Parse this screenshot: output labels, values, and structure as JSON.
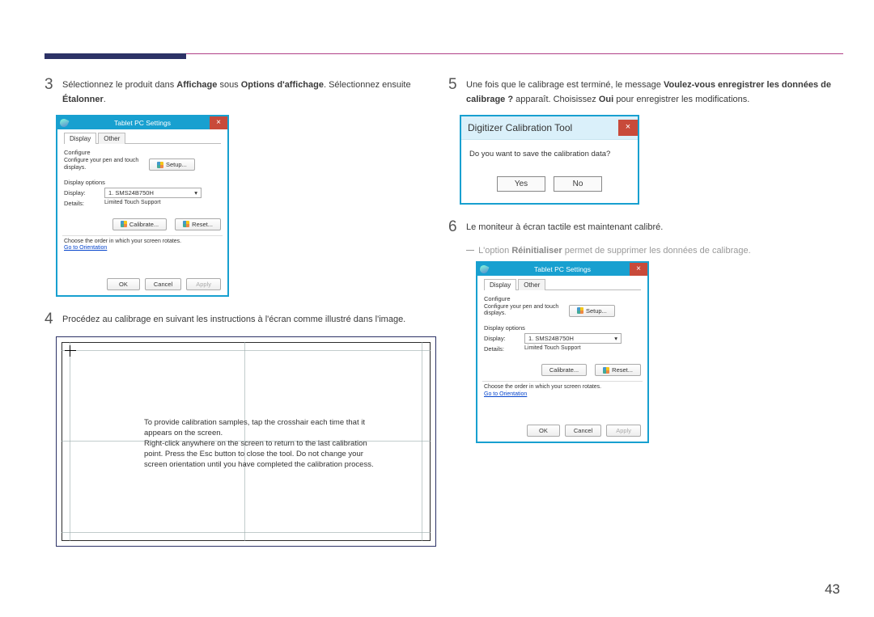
{
  "page_number": "43",
  "step3": {
    "num": "3",
    "text_parts": [
      "Sélectionnez le produit dans ",
      "Affichage",
      " sous ",
      "Options d'affichage",
      ". Sélectionnez ensuite ",
      "Étalonner",
      "."
    ]
  },
  "step4": {
    "num": "4",
    "text": "Procédez au calibrage en suivant les instructions à l'écran comme illustré dans l'image."
  },
  "step5": {
    "num": "5",
    "text_parts": [
      "Une fois que le calibrage est terminé, le message ",
      "Voulez-vous enregistrer les données de calibrage ?",
      " apparaît. Choisissez ",
      "Oui",
      " pour enregistrer les modifications."
    ]
  },
  "step6": {
    "num": "6",
    "text": "Le moniteur à écran tactile est maintenant calibré."
  },
  "note": {
    "text_parts": [
      "L'option ",
      "Réinitialiser",
      " permet de supprimer les données de calibrage."
    ]
  },
  "settings_win": {
    "title": "Tablet PC Settings",
    "tabs": {
      "display": "Display",
      "other": "Other"
    },
    "configure_label": "Configure",
    "configure_text": "Configure your pen and touch displays.",
    "setup_btn": "Setup...",
    "display_options_label": "Display options",
    "display_label": "Display:",
    "display_value": "1. SMS24B750H",
    "details_label": "Details:",
    "details_value": "Limited Touch Support",
    "calibrate_btn": "Calibrate...",
    "reset_btn": "Reset...",
    "rotate_text": "Choose the order in which your screen rotates.",
    "orientation_link": "Go to Orientation",
    "ok": "OK",
    "cancel": "Cancel",
    "apply": "Apply"
  },
  "calib_screen": {
    "text": "To provide calibration samples, tap the crosshair each time that it appears on the screen.\nRight-click anywhere on the screen to return to the last calibration point. Press the Esc button to close the tool. Do not change your screen orientation until you have completed the calibration process."
  },
  "digitizer_dialog": {
    "title": "Digitizer Calibration Tool",
    "question": "Do you want to save the calibration data?",
    "yes": "Yes",
    "no": "No"
  }
}
